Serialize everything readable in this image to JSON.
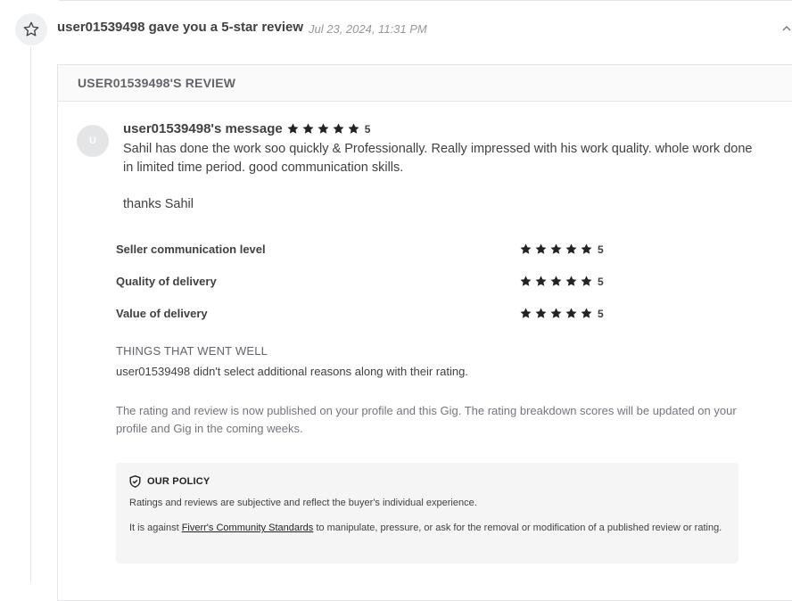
{
  "notification": {
    "title": "user01539498 gave you a 5-star review",
    "date": "Jul 23, 2024, 11:31 PM"
  },
  "review": {
    "header": "USER01539498'S REVIEW",
    "avatar_letter": "U",
    "sender": "user01539498's message",
    "overall_rating": "5",
    "message": "Sahil has done the work soo quickly & Professionally. Really impressed with his work quality. whole work done in limited time period. good communication skills.",
    "thanks": "thanks Sahil",
    "breakdown": [
      {
        "label": "Seller communication level",
        "value": "5"
      },
      {
        "label": "Quality of delivery",
        "value": "5"
      },
      {
        "label": "Value of delivery",
        "value": "5"
      }
    ],
    "things_title": "THINGS THAT WENT WELL",
    "things_text": "user01539498 didn't select additional reasons along with their rating.",
    "note": "The rating and review is now published on your profile and this Gig. The rating breakdown scores will be updated on your profile and Gig in the coming weeks."
  },
  "policy": {
    "title": "OUR POLICY",
    "line1": "Ratings and reviews are subjective and reflect the buyer's individual experience.",
    "line2_before": "It is against ",
    "line2_link": "Fiverr's Community Standards",
    "line2_after": " to manipulate, pressure, or ask for the removal or modification of a published review or rating."
  },
  "icons": {
    "badge": "star-outline-icon",
    "rating_star": "star-filled-icon",
    "policy": "shield-check-icon",
    "collapse": "chevron-up-icon"
  },
  "colors": {
    "star": "#222325",
    "text": "#404145",
    "muted": "#74767e",
    "policy_bg": "#f5f5f5"
  }
}
